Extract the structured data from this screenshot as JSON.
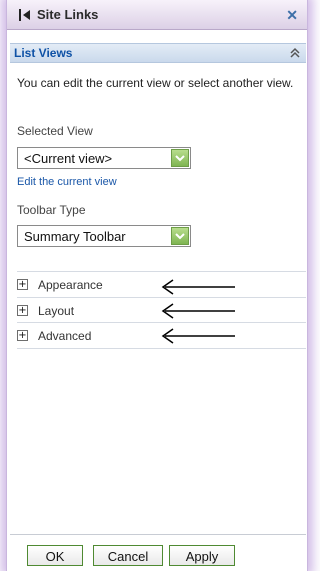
{
  "panel": {
    "title": "Site Links",
    "close_glyph": "✕",
    "back_icon": "triangle-left-icon"
  },
  "section": {
    "title": "List Views",
    "collapse_icon": "chevron-double-up-icon"
  },
  "description": "You can edit the current view or select another view.",
  "selected_view": {
    "label": "Selected View",
    "value": "<Current view>",
    "edit_link": "Edit the current view"
  },
  "toolbar_type": {
    "label": "Toolbar Type",
    "value": "Summary Toolbar"
  },
  "expanders": [
    {
      "label": "Appearance",
      "icon": "plus-icon"
    },
    {
      "label": "Layout",
      "icon": "plus-icon"
    },
    {
      "label": "Advanced",
      "icon": "plus-icon"
    }
  ],
  "buttons": {
    "ok": "OK",
    "cancel": "Cancel",
    "apply": "Apply"
  },
  "colors": {
    "accent_blue": "#0f52a6",
    "dropdown_green": "#8fc462",
    "frame_glow": "#aa82d2"
  }
}
